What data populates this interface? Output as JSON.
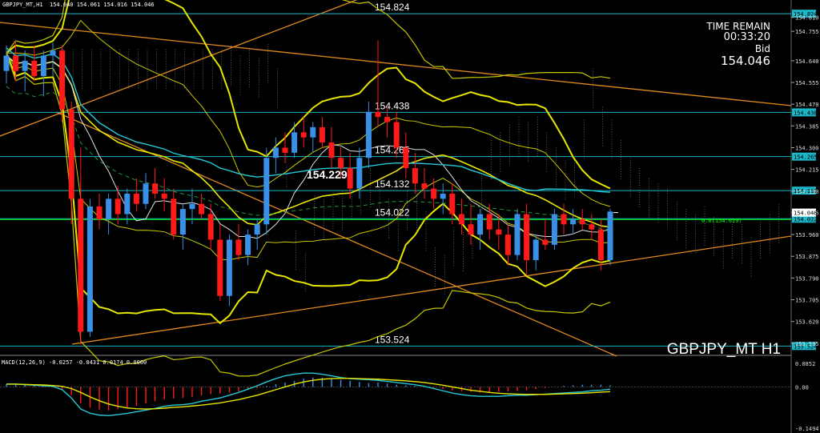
{
  "header": {
    "symbol": "GBPJPY_MT,H1",
    "ohlc": "154.040 154.061 154.016 154.046"
  },
  "hud": {
    "time_remain_label": "TIME REMAIN",
    "time_remain_value": "00:33:20",
    "bid_label": "Bid",
    "bid_value": "154.046"
  },
  "watermark": "GBPJPY_MT H1",
  "levels": [
    {
      "label": "154.824",
      "value": 154.824,
      "tag": "154.824"
    },
    {
      "label": "154.438",
      "value": 154.438,
      "tag": "154.438"
    },
    {
      "label": "154.265",
      "value": 154.265,
      "tag": "154.265"
    },
    {
      "label": "154.132",
      "value": 154.132,
      "tag": "154.132"
    },
    {
      "label": "154.022",
      "value": 154.022,
      "tag": "154.022"
    },
    {
      "label": "153.524",
      "value": 153.524,
      "tag": "153.524"
    }
  ],
  "fib_label": "0.0(154.019)",
  "bold_level_label": "154.229",
  "colors": {
    "bull": "#3a8fe6",
    "bear": "#ff1a1a",
    "bollinger": "#e6e600",
    "envelope": "#c8c800",
    "trend": "#e08a1e",
    "level": "#19b6c8",
    "fib": "#00ff00",
    "ma": "#24c9d8",
    "grid": "#2a2a2a"
  },
  "chart_data": [
    {
      "type": "candlestick",
      "title": "",
      "ylim": [
        153.5,
        154.84
      ],
      "y_ticks": [
        154.81,
        154.755,
        154.64,
        154.555,
        154.47,
        154.385,
        154.3,
        154.215,
        154.13,
        154.046,
        153.96,
        153.875,
        153.79,
        153.705,
        153.62,
        153.535
      ],
      "price_tags": [
        "154.824",
        "154.438",
        "154.265",
        "154.132",
        "154.046",
        "154.022",
        "153.524"
      ],
      "current_price": 154.046,
      "candles": [
        [
          154.6,
          154.7,
          154.55,
          154.66
        ],
        [
          154.66,
          154.72,
          154.56,
          154.6
        ],
        [
          154.6,
          154.68,
          154.52,
          154.64
        ],
        [
          154.64,
          154.7,
          154.56,
          154.58
        ],
        [
          154.58,
          154.68,
          154.5,
          154.66
        ],
        [
          154.66,
          154.71,
          154.58,
          154.68
        ],
        [
          154.68,
          154.7,
          154.4,
          154.45
        ],
        [
          154.45,
          154.48,
          154.0,
          154.1
        ],
        [
          154.1,
          154.3,
          153.53,
          153.58
        ],
        [
          153.58,
          154.1,
          153.56,
          154.07
        ],
        [
          154.07,
          154.12,
          153.98,
          154.02
        ],
        [
          154.02,
          154.12,
          153.96,
          154.1
        ],
        [
          154.1,
          154.15,
          154.0,
          154.04
        ],
        [
          154.04,
          154.14,
          154.0,
          154.12
        ],
        [
          154.12,
          154.18,
          154.05,
          154.08
        ],
        [
          154.08,
          154.2,
          154.06,
          154.16
        ],
        [
          154.16,
          154.22,
          154.1,
          154.12
        ],
        [
          154.12,
          154.18,
          154.05,
          154.1
        ],
        [
          154.1,
          154.14,
          153.94,
          153.96
        ],
        [
          153.96,
          154.08,
          153.9,
          154.06
        ],
        [
          154.06,
          154.14,
          154.0,
          154.08
        ],
        [
          154.08,
          154.12,
          154.02,
          154.04
        ],
        [
          154.04,
          154.08,
          153.9,
          153.94
        ],
        [
          153.94,
          154.0,
          153.7,
          153.72
        ],
        [
          153.72,
          153.96,
          153.68,
          153.94
        ],
        [
          153.94,
          154.0,
          153.86,
          153.88
        ],
        [
          153.88,
          153.98,
          153.84,
          153.96
        ],
        [
          153.96,
          154.02,
          153.9,
          154.0
        ],
        [
          154.0,
          154.3,
          153.96,
          154.26
        ],
        [
          154.26,
          154.34,
          154.2,
          154.3
        ],
        [
          154.3,
          154.36,
          154.24,
          154.28
        ],
        [
          154.28,
          154.4,
          154.26,
          154.36
        ],
        [
          154.36,
          154.42,
          154.3,
          154.34
        ],
        [
          154.34,
          154.4,
          154.28,
          154.38
        ],
        [
          154.38,
          154.42,
          154.3,
          154.32
        ],
        [
          154.32,
          154.38,
          154.22,
          154.26
        ],
        [
          154.26,
          154.3,
          154.18,
          154.22
        ],
        [
          154.22,
          154.28,
          154.1,
          154.14
        ],
        [
          154.14,
          154.3,
          154.1,
          154.26
        ],
        [
          154.26,
          154.48,
          154.22,
          154.44
        ],
        [
          154.44,
          154.72,
          154.38,
          154.42
        ],
        [
          154.42,
          154.46,
          154.34,
          154.4
        ],
        [
          154.4,
          154.44,
          154.26,
          154.3
        ],
        [
          154.3,
          154.36,
          154.18,
          154.22
        ],
        [
          154.22,
          154.28,
          154.12,
          154.16
        ],
        [
          154.16,
          154.22,
          154.1,
          154.14
        ],
        [
          154.14,
          154.18,
          154.06,
          154.1
        ],
        [
          154.1,
          154.16,
          154.04,
          154.12
        ],
        [
          154.12,
          154.16,
          154.0,
          154.04
        ],
        [
          154.04,
          154.1,
          153.96,
          154.0
        ],
        [
          154.0,
          154.08,
          153.92,
          153.96
        ],
        [
          153.96,
          154.06,
          153.9,
          154.04
        ],
        [
          154.04,
          154.08,
          153.94,
          153.98
        ],
        [
          153.98,
          154.04,
          153.9,
          153.96
        ],
        [
          153.96,
          154.0,
          153.84,
          153.88
        ],
        [
          153.88,
          154.06,
          153.86,
          154.04
        ],
        [
          154.04,
          154.08,
          153.8,
          153.86
        ],
        [
          153.86,
          153.96,
          153.82,
          153.94
        ],
        [
          153.94,
          154.02,
          153.9,
          153.92
        ],
        [
          153.92,
          154.06,
          153.9,
          154.04
        ],
        [
          154.04,
          154.08,
          153.96,
          154.0
        ],
        [
          154.0,
          154.06,
          153.96,
          154.02
        ],
        [
          154.02,
          154.06,
          153.98,
          154.0
        ],
        [
          154.0,
          154.04,
          153.94,
          153.98
        ],
        [
          153.98,
          154.02,
          153.82,
          153.86
        ],
        [
          153.86,
          154.06,
          153.84,
          154.05
        ]
      ]
    },
    {
      "type": "bar",
      "title": "MACD(12,26,9) -0.0257 -0.0431 0.0174 0.0000",
      "ylim": [
        -0.1494,
        0.0852
      ],
      "y_ticks": [
        "0.0852",
        "0.00",
        "-0.1494"
      ],
      "histogram": [
        0.01,
        0.012,
        0.008,
        0.006,
        0.004,
        0.002,
        -0.01,
        -0.03,
        -0.06,
        -0.075,
        -0.082,
        -0.085,
        -0.08,
        -0.075,
        -0.068,
        -0.06,
        -0.052,
        -0.045,
        -0.042,
        -0.04,
        -0.036,
        -0.03,
        -0.026,
        -0.024,
        -0.02,
        -0.016,
        -0.01,
        -0.004,
        0.004,
        0.01,
        0.016,
        0.022,
        0.03,
        0.034,
        0.034,
        0.03,
        0.026,
        0.022,
        0.018,
        0.014,
        0.016,
        0.012,
        0.008,
        0.006,
        0.004,
        0.002,
        -0.004,
        -0.008,
        -0.012,
        -0.016,
        -0.018,
        -0.02,
        -0.02,
        -0.018,
        -0.016,
        -0.014,
        -0.012,
        -0.008,
        -0.004,
        0.0,
        0.004,
        0.006,
        0.008,
        0.008,
        0.008,
        0.006
      ],
      "macd": [
        0.01,
        0.01,
        0.008,
        0.006,
        0.004,
        0.002,
        -0.01,
        -0.04,
        -0.08,
        -0.095,
        -0.102,
        -0.104,
        -0.1,
        -0.096,
        -0.09,
        -0.084,
        -0.078,
        -0.07,
        -0.066,
        -0.064,
        -0.06,
        -0.052,
        -0.046,
        -0.04,
        -0.03,
        -0.02,
        -0.008,
        0.004,
        0.018,
        0.03,
        0.04,
        0.046,
        0.05,
        0.05,
        0.046,
        0.04,
        0.034,
        0.03,
        0.028,
        0.026,
        0.024,
        0.02,
        0.016,
        0.012,
        0.008,
        0.002,
        -0.006,
        -0.014,
        -0.022,
        -0.028,
        -0.032,
        -0.034,
        -0.034,
        -0.034,
        -0.032,
        -0.03,
        -0.03,
        -0.028,
        -0.026,
        -0.024,
        -0.022,
        -0.02,
        -0.018,
        -0.014,
        -0.012,
        -0.008
      ],
      "signal": [
        0.01,
        0.01,
        0.009,
        0.008,
        0.007,
        0.005,
        0.002,
        -0.006,
        -0.02,
        -0.036,
        -0.05,
        -0.062,
        -0.07,
        -0.076,
        -0.079,
        -0.08,
        -0.079,
        -0.077,
        -0.074,
        -0.072,
        -0.069,
        -0.066,
        -0.062,
        -0.058,
        -0.052,
        -0.046,
        -0.038,
        -0.03,
        -0.02,
        -0.01,
        0.0,
        0.01,
        0.018,
        0.024,
        0.028,
        0.03,
        0.031,
        0.031,
        0.03,
        0.029,
        0.028,
        0.026,
        0.024,
        0.022,
        0.019,
        0.016,
        0.011,
        0.006,
        0.0,
        -0.006,
        -0.012,
        -0.016,
        -0.02,
        -0.023,
        -0.025,
        -0.026,
        -0.027,
        -0.027,
        -0.027,
        -0.026,
        -0.025,
        -0.024,
        -0.023,
        -0.021,
        -0.019,
        -0.017
      ]
    }
  ]
}
